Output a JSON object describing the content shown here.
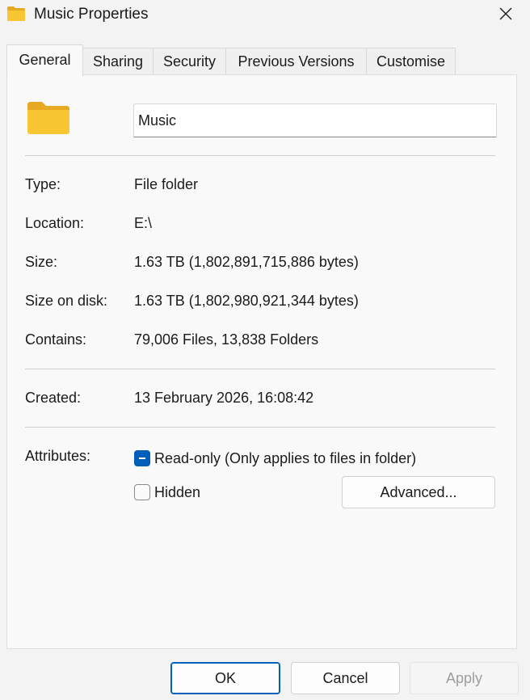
{
  "window": {
    "title": "Music Properties",
    "title_icon": "folder-icon",
    "close_icon": "close-icon"
  },
  "tabs": [
    {
      "label": "General",
      "active": true
    },
    {
      "label": "Sharing",
      "active": false
    },
    {
      "label": "Security",
      "active": false
    },
    {
      "label": "Previous Versions",
      "active": false
    },
    {
      "label": "Customise",
      "active": false
    }
  ],
  "general": {
    "name_value": "Music",
    "type_label": "Type:",
    "type_value": "File folder",
    "location_label": "Location:",
    "location_value": "E:\\",
    "size_label": "Size:",
    "size_value": "1.63 TB (1,802,891,715,886 bytes)",
    "size_on_disk_label": "Size on disk:",
    "size_on_disk_value": "1.63 TB (1,802,980,921,344 bytes)",
    "contains_label": "Contains:",
    "contains_value": "79,006 Files, 13,838 Folders",
    "created_label": "Created:",
    "created_value": "13 February 2026, 16:08:42",
    "attributes_label": "Attributes:",
    "readonly_label": "Read-only (Only applies to files in folder)",
    "readonly_state": "indeterminate",
    "hidden_label": "Hidden",
    "hidden_state": "unchecked",
    "advanced_label": "Advanced..."
  },
  "footer": {
    "ok_label": "OK",
    "cancel_label": "Cancel",
    "apply_label": "Apply"
  },
  "colors": {
    "accent": "#005fb8",
    "folder_yellow": "#f8c633",
    "window_bg": "#f3f3f3",
    "panel_bg": "#f9f9f9"
  }
}
